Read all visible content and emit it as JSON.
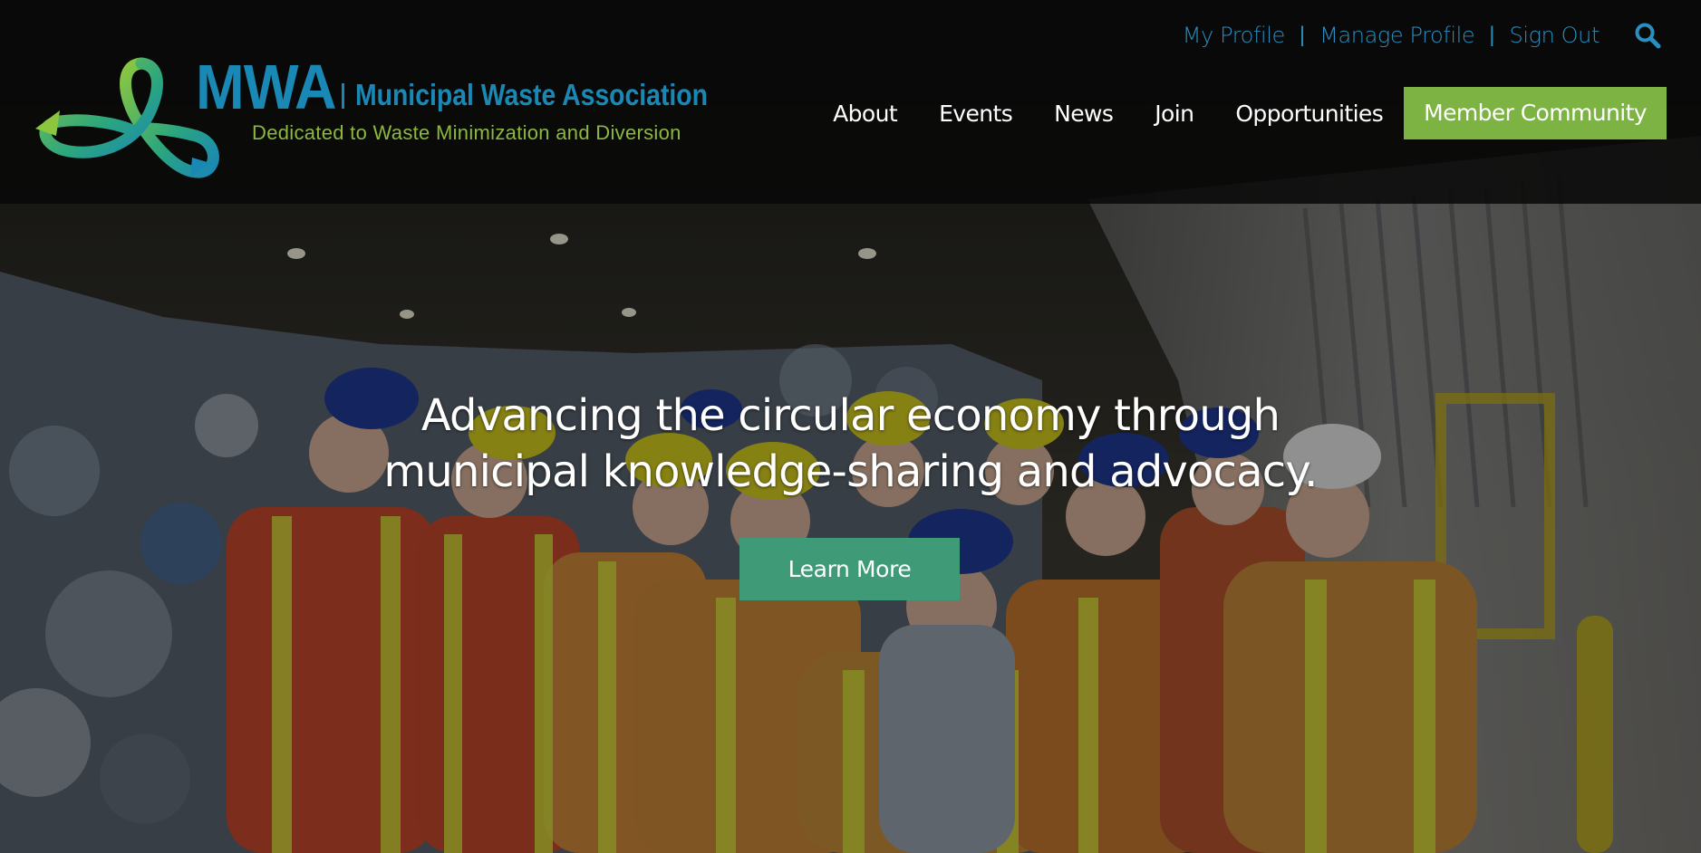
{
  "header": {
    "logo": {
      "abbr": "MWA",
      "name": "Municipal Waste Association",
      "tagline": "Dedicated to Waste Minimization and Diversion",
      "icon": "infinity-loop-logo-icon"
    },
    "utility_links": [
      {
        "label": "My Profile"
      },
      {
        "label": "Manage Profile"
      },
      {
        "label": "Sign Out"
      }
    ],
    "search_icon": "search-icon",
    "nav": [
      {
        "label": "About"
      },
      {
        "label": "Events"
      },
      {
        "label": "News"
      },
      {
        "label": "Join"
      },
      {
        "label": "Opportunities"
      }
    ],
    "member_button": "Member Community"
  },
  "hero": {
    "headline_line1": "Advancing the circular economy through",
    "headline_line2": "municipal knowledge-sharing and advocacy.",
    "cta_label": "Learn More"
  },
  "colors": {
    "brand_blue": "#1a88b4",
    "brand_green": "#8cb83f",
    "member_button_bg": "#7cb342",
    "cta_bg": "#3f9b77",
    "header_bg": "#080808"
  }
}
